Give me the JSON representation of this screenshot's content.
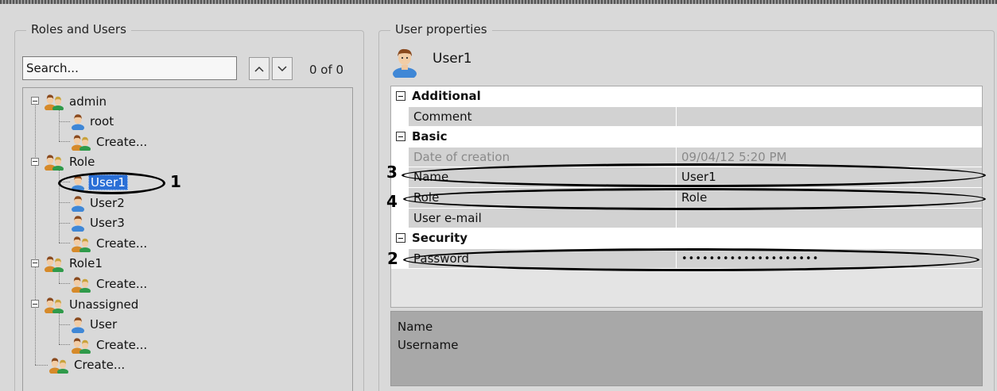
{
  "roles_panel": {
    "title": "Roles and Users",
    "search": {
      "placeholder": "Search...",
      "value": ""
    },
    "match_count": "0 of 0",
    "up_icon": "chevron-up-icon",
    "down_icon": "chevron-down-icon",
    "tree": [
      {
        "label": "admin",
        "type": "role",
        "expanded": true,
        "children": [
          {
            "label": "root",
            "type": "user"
          },
          {
            "label": "Create...",
            "type": "create"
          }
        ]
      },
      {
        "label": "Role",
        "type": "role",
        "expanded": true,
        "children": [
          {
            "label": "User1",
            "type": "user",
            "selected": true
          },
          {
            "label": "User2",
            "type": "user"
          },
          {
            "label": "User3",
            "type": "user"
          },
          {
            "label": "Create...",
            "type": "create"
          }
        ]
      },
      {
        "label": "Role1",
        "type": "role",
        "expanded": true,
        "children": [
          {
            "label": "Create...",
            "type": "create"
          }
        ]
      },
      {
        "label": "Unassigned",
        "type": "role",
        "expanded": true,
        "children": [
          {
            "label": "User",
            "type": "user"
          },
          {
            "label": "Create...",
            "type": "create"
          }
        ]
      },
      {
        "label": "Create...",
        "type": "create"
      }
    ]
  },
  "properties_panel": {
    "title": "User properties",
    "user_name": "User1",
    "user_icon": "user-icon",
    "categories": [
      {
        "label": "Additional",
        "rows": [
          {
            "name": "Comment",
            "value": ""
          }
        ]
      },
      {
        "label": "Basic",
        "rows": [
          {
            "name": "Date of creation",
            "value": "09/04/12 5:20 PM",
            "readonly": true
          },
          {
            "name": "Name",
            "value": "User1"
          },
          {
            "name": "Role",
            "value": "Role"
          },
          {
            "name": "User e-mail",
            "value": ""
          }
        ]
      },
      {
        "label": "Security",
        "rows": [
          {
            "name": "Password",
            "value": "••••••••••••••••••••",
            "password": true
          }
        ]
      }
    ],
    "description": {
      "title": "Name",
      "text": "Username"
    }
  },
  "annotations": [
    "1",
    "2",
    "3",
    "4"
  ],
  "colors": {
    "selection": "#2a6fd6",
    "panel_bg": "#d9d9d9",
    "grid_cell": "#d2d2d2",
    "description_bg": "#a8a8a8"
  }
}
